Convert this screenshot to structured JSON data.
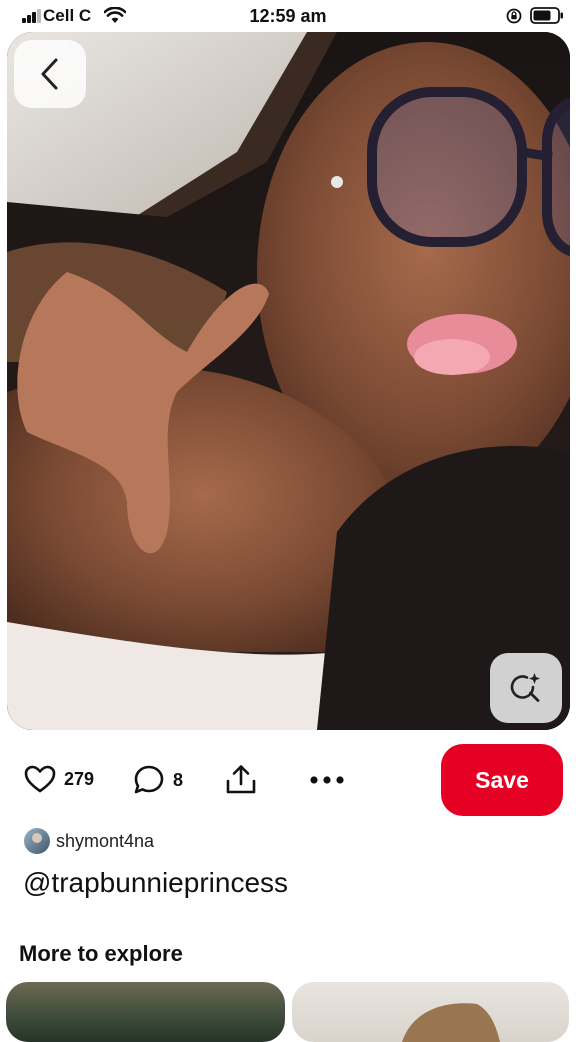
{
  "status_bar": {
    "carrier": "Cell C",
    "time": "12:59 am"
  },
  "pin": {
    "image_alt": "",
    "creator": "shymont4na",
    "title": "@trapbunnieprincess"
  },
  "actions": {
    "likes": "279",
    "comments": "8",
    "save_label": "Save"
  },
  "more": {
    "header": "More to explore"
  },
  "colors": {
    "save": "#e60023"
  },
  "icons": [
    "back-chevron-icon",
    "visual-search-icon",
    "heart-icon",
    "comment-icon",
    "share-icon",
    "more-dots-icon"
  ]
}
